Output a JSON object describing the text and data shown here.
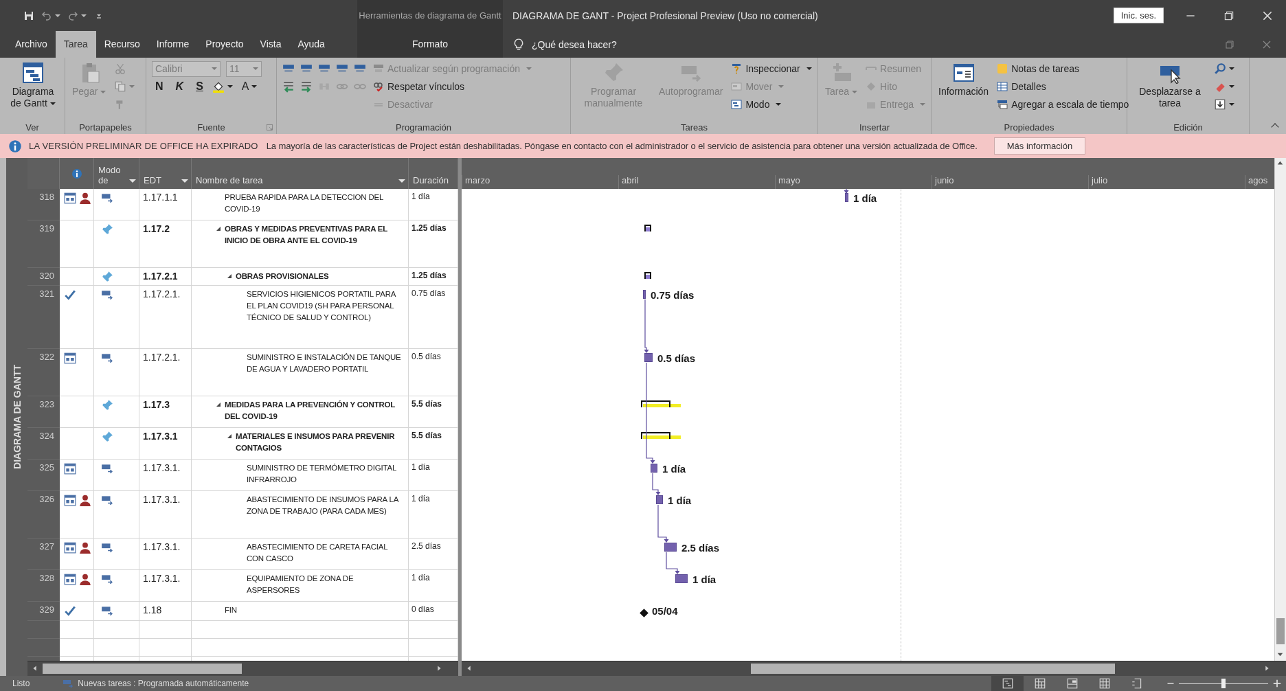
{
  "title_bar": {
    "context_group": "Herramientas de diagrama de Gantt",
    "title": "DIAGRAMA DE GANT - Project Profesional Preview (Uso no comercial)",
    "sign_in": "Inic. ses."
  },
  "tabs": [
    {
      "label": "Archivo",
      "selected": false,
      "kind": "main"
    },
    {
      "label": "Tarea",
      "selected": true,
      "kind": "main"
    },
    {
      "label": "Recurso",
      "selected": false,
      "kind": "main"
    },
    {
      "label": "Informe",
      "selected": false,
      "kind": "main"
    },
    {
      "label": "Proyecto",
      "selected": false,
      "kind": "main"
    },
    {
      "label": "Vista",
      "selected": false,
      "kind": "main"
    },
    {
      "label": "Ayuda",
      "selected": false,
      "kind": "main"
    },
    {
      "label": "Formato",
      "selected": false,
      "kind": "context"
    }
  ],
  "tell_me": {
    "placeholder": "¿Qué desea hacer?"
  },
  "ribbon": {
    "groups": [
      {
        "label": "Ver",
        "columns": [
          [
            [
              {
                "kind": "large",
                "label": "Diagrama de Gantt",
                "dropdown": true,
                "disabled": false
              }
            ]
          ]
        ]
      },
      {
        "label": "Portapapeles",
        "columns": [
          [
            [
              {
                "kind": "large",
                "label": "Pegar",
                "dropdown": true,
                "disabled": true
              }
            ]
          ],
          [
            [
              {
                "kind": "icon",
                "disabled": true
              }
            ],
            [
              {
                "kind": "icon",
                "dropdown": true,
                "disabled": true
              }
            ],
            [
              {
                "kind": "icon",
                "disabled": true
              }
            ]
          ]
        ]
      },
      {
        "label": "Fuente",
        "launcher": true,
        "columns": [
          [
            [
              {
                "kind": "field",
                "value": "Calibri",
                "dropdown": true,
                "disabled": true
              },
              {
                "kind": "field",
                "value": "11",
                "dropdown": true,
                "disabled": true
              }
            ],
            [
              {
                "kind": "bold",
                "label": "N",
                "disabled": false
              },
              {
                "kind": "italic",
                "label": "K",
                "disabled": false
              },
              {
                "kind": "underline",
                "label": "S",
                "disabled": false
              },
              {
                "kind": "icon",
                "dropdown": true,
                "disabled": false
              },
              {
                "kind": "font_color",
                "label": "A",
                "dropdown": true,
                "disabled": false
              }
            ]
          ]
        ]
      },
      {
        "label": "Programación",
        "columns": [
          [
            [
              {
                "kind": "icon",
                "disabled": false
              },
              {
                "kind": "icon",
                "disabled": false
              },
              {
                "kind": "icon",
                "disabled": false
              },
              {
                "kind": "icon",
                "disabled": false
              },
              {
                "kind": "icon",
                "disabled": false
              }
            ],
            [
              {
                "kind": "icon",
                "disabled": false
              },
              {
                "kind": "icon",
                "disabled": false
              },
              {
                "kind": "icon",
                "disabled": true
              },
              {
                "kind": "icon",
                "disabled": true
              },
              {
                "kind": "icon",
                "disabled": true
              }
            ]
          ],
          [
            [
              {
                "kind": "small",
                "label": "Actualizar según programación",
                "dropdown": true,
                "disabled": true
              }
            ],
            [
              {
                "kind": "small",
                "label": "Respetar vínculos",
                "disabled": false
              }
            ],
            [
              {
                "kind": "small",
                "label": "Desactivar",
                "disabled": true
              }
            ]
          ]
        ]
      },
      {
        "label": "Tareas",
        "columns": [
          [
            [
              {
                "kind": "large",
                "label": "Programar manualmente",
                "disabled": true
              }
            ]
          ],
          [
            [
              {
                "kind": "large",
                "label": "Autoprogramar",
                "disabled": true
              }
            ]
          ],
          [
            [
              {
                "kind": "small",
                "label": "Inspeccionar",
                "dropdown": true,
                "disabled": false
              }
            ],
            [
              {
                "kind": "small",
                "label": "Mover",
                "dropdown": true,
                "disabled": true
              }
            ],
            [
              {
                "kind": "small",
                "label": "Modo",
                "dropdown": true,
                "disabled": false
              }
            ]
          ]
        ]
      },
      {
        "label": "Insertar",
        "columns": [
          [
            [
              {
                "kind": "large",
                "label": "Tarea",
                "dropdown": true,
                "disabled": true
              }
            ]
          ],
          [
            [
              {
                "kind": "small",
                "label": "Resumen",
                "disabled": true
              }
            ],
            [
              {
                "kind": "small",
                "label": "Hito",
                "disabled": true
              }
            ],
            [
              {
                "kind": "small",
                "label": "Entrega",
                "dropdown": true,
                "disabled": true
              }
            ]
          ]
        ]
      },
      {
        "label": "Propiedades",
        "columns": [
          [
            [
              {
                "kind": "large",
                "label": "Información",
                "disabled": false
              }
            ]
          ],
          [
            [
              {
                "kind": "small",
                "label": "Notas de tareas",
                "disabled": false
              }
            ],
            [
              {
                "kind": "small",
                "label": "Detalles",
                "disabled": false
              }
            ],
            [
              {
                "kind": "small",
                "label": "Agregar a escala de tiempo",
                "disabled": false
              }
            ]
          ]
        ]
      },
      {
        "label": "Edición",
        "columns": [
          [
            [
              {
                "kind": "large",
                "label": "Desplazarse a tarea",
                "disabled": false
              }
            ]
          ],
          [
            [
              {
                "kind": "icon",
                "dropdown": true,
                "disabled": false
              }
            ],
            [
              {
                "kind": "icon",
                "dropdown": true,
                "disabled": false
              }
            ],
            [
              {
                "kind": "icon",
                "dropdown": true,
                "disabled": false
              }
            ]
          ]
        ]
      }
    ]
  },
  "notice": {
    "title": "LA VERSIÓN PRELIMINAR DE OFFICE HA EXPIRADO",
    "message": "La mayoría de las características de Project están deshabilitadas. Póngase en contacto con el administrador o el servicio de asistencia para obtener una versión actualizada de Office.",
    "button": "Más información"
  },
  "view_label": "DIAGRAMA DE GANTT",
  "table": {
    "columns": [
      {
        "label": "Modo de",
        "filter": true
      },
      {
        "label": "EDT",
        "filter": true
      },
      {
        "label": "Nombre de tarea",
        "filter": true
      },
      {
        "label": "Duración",
        "filter": false
      }
    ],
    "rows": [
      {
        "id": "318",
        "completed": false,
        "calendar": true,
        "resource": true,
        "manually_scheduled": false,
        "edt": "1.17.1.1",
        "name": "PRUEBA RAPIDA PARA LA DETECCION DEL COVID-19",
        "duration": "1 día",
        "summary": false,
        "bar": {
          "kind": "task",
          "label": "1 día"
        }
      },
      {
        "id": "319",
        "completed": false,
        "calendar": false,
        "resource": false,
        "manually_scheduled": true,
        "edt": "1.17.2",
        "name": "OBRAS Y MEDIDAS PREVENTIVAS PARA EL INICIO DE OBRA ANTE EL COVID-19",
        "duration": "1.25 días",
        "summary": true,
        "expanded": true,
        "bar": {
          "kind": "summary"
        },
        "children": [
          {
            "id": "320",
            "completed": false,
            "calendar": false,
            "resource": false,
            "manually_scheduled": true,
            "edt": "1.17.2.1",
            "name": "OBRAS PROVISIONALES",
            "duration": "1.25 días",
            "summary": true,
            "expanded": true,
            "bar": {
              "kind": "summary"
            },
            "children": [
              {
                "id": "321",
                "completed": true,
                "calendar": false,
                "resource": false,
                "manually_scheduled": false,
                "edt": "1.17.2.1.",
                "name": "SERVICIOS HIGIENICOS PORTATIL PARA EL PLAN COVID19 (SH PARA PERSONAL TÉCNICO DE SALUD Y CONTROL)",
                "duration": "0.75 días",
                "summary": false,
                "bar": {
                  "kind": "task",
                  "label": "0.75 días"
                }
              },
              {
                "id": "322",
                "completed": false,
                "calendar": true,
                "resource": false,
                "manually_scheduled": false,
                "edt": "1.17.2.1.",
                "name": "SUMINISTRO E INSTALACIÓN DE TANQUE DE AGUA Y LAVADERO PORTATIL",
                "duration": "0.5 días",
                "summary": false,
                "bar": {
                  "kind": "task",
                  "label": "0.5 días"
                }
              }
            ]
          }
        ]
      },
      {
        "id": "323",
        "completed": false,
        "calendar": false,
        "resource": false,
        "manually_scheduled": true,
        "edt": "1.17.3",
        "name": "MEDIDAS PARA LA PREVENCIÓN Y CONTROL DEL COVID-19",
        "duration": "5.5 días",
        "summary": true,
        "expanded": true,
        "bar": {
          "kind": "summary",
          "highlighted": true
        },
        "children": [
          {
            "id": "324",
            "completed": false,
            "calendar": false,
            "resource": false,
            "manually_scheduled": true,
            "edt": "1.17.3.1",
            "name": "MATERIALES E INSUMOS PARA PREVENIR CONTAGIOS",
            "duration": "5.5 días",
            "summary": true,
            "expanded": true,
            "bar": {
              "kind": "summary",
              "highlighted": true
            },
            "children": [
              {
                "id": "325",
                "completed": false,
                "calendar": true,
                "resource": false,
                "manually_scheduled": false,
                "edt": "1.17.3.1.",
                "name": "SUMINISTRO DE TERMÓMETRO DIGITAL INFRARROJO",
                "duration": "1 día",
                "summary": false,
                "bar": {
                  "kind": "task",
                  "label": "1 día"
                }
              },
              {
                "id": "326",
                "completed": false,
                "calendar": true,
                "resource": true,
                "manually_scheduled": false,
                "edt": "1.17.3.1.",
                "name": "ABASTECIMIENTO DE INSUMOS PARA LA ZONA DE TRABAJO (PARA CADA MES)",
                "duration": "1 día",
                "summary": false,
                "bar": {
                  "kind": "task",
                  "label": "1 día"
                }
              },
              {
                "id": "327",
                "completed": false,
                "calendar": true,
                "resource": true,
                "manually_scheduled": false,
                "edt": "1.17.3.1.",
                "name": "ABASTECIMIENTO DE CARETA FACIAL CON CASCO",
                "duration": "2.5 días",
                "summary": false,
                "bar": {
                  "kind": "task",
                  "label": "2.5 días"
                }
              },
              {
                "id": "328",
                "completed": false,
                "calendar": true,
                "resource": true,
                "manually_scheduled": false,
                "edt": "1.17.3.1.",
                "name": "EQUIPAMIENTO DE ZONA DE ASPERSORES",
                "duration": "1 día",
                "summary": false,
                "bar": {
                  "kind": "task",
                  "label": "1 día"
                }
              }
            ]
          }
        ]
      },
      {
        "id": "329",
        "completed": true,
        "calendar": false,
        "resource": false,
        "manually_scheduled": false,
        "edt": "1.18",
        "name": "FIN",
        "duration": "0 días",
        "summary": false,
        "bar": {
          "kind": "milestone",
          "label": "05/04"
        }
      }
    ]
  },
  "gantt": {
    "months": [
      "marzo",
      "abril",
      "mayo",
      "junio",
      "julio",
      "agos"
    ]
  },
  "status_bar": {
    "ready": "Listo",
    "new_tasks": "Nuevas tareas : Programada automáticamente",
    "views": [
      {
        "selected": true
      },
      {
        "selected": false
      },
      {
        "selected": false
      },
      {
        "selected": false
      },
      {
        "selected": false
      }
    ],
    "zoom": {
      "level": 0.5
    }
  }
}
